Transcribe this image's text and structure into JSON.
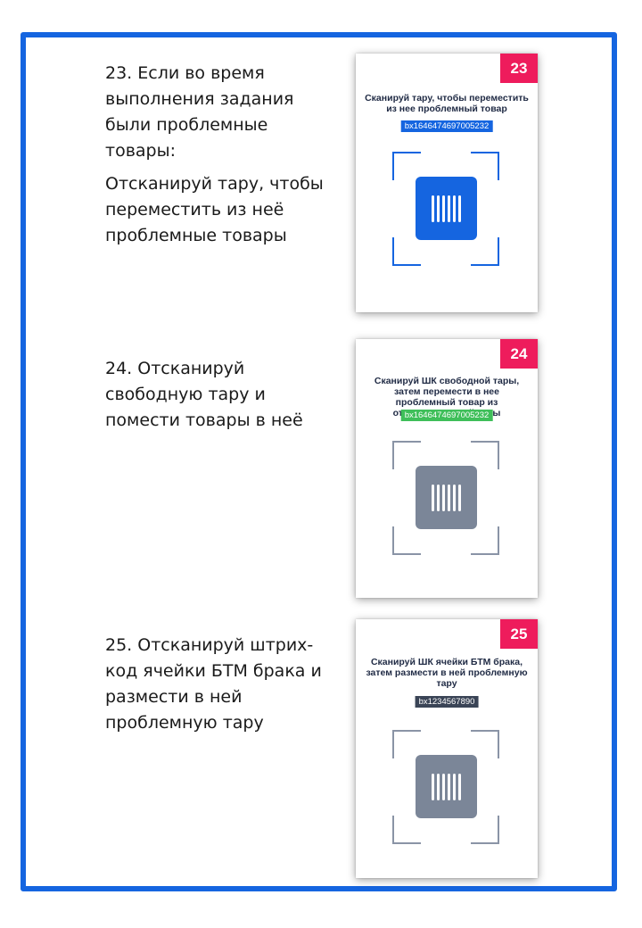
{
  "steps": [
    {
      "paragraphs": [
        "23. Если во время выполнения задания были проблемные товары:",
        "Отсканируй тару, чтобы переместить из неё проблемные товары"
      ],
      "screen": {
        "badge": "23",
        "prompt": "Сканируй тару, чтобы переместить из нее проблемный товар",
        "code": "bx1646474697005232",
        "code_color": "#1565e0",
        "frame_color": "#1565e0",
        "barcode_color": "#1565e0",
        "icon": "barcode-icon"
      }
    },
    {
      "paragraphs": [
        "24. Отсканируй свободную тару и помести товары в неё"
      ],
      "screen": {
        "badge": "24",
        "prompt": "Сканируй ШК свободной тары, затем перемести в нее проблемный товар из отсканированной тары",
        "code": "bx1646474697005232",
        "code_color": "#3fbf5a",
        "frame_color": "#8a94a6",
        "barcode_color": "#7b8698",
        "icon": "barcode-icon"
      }
    },
    {
      "paragraphs": [
        "25. Отсканируй штрих-код ячейки БТМ брака и размести в ней проблемную тару"
      ],
      "screen": {
        "badge": "25",
        "prompt": "Сканируй ШК ячейки БТМ брака, затем размести в ней проблемную тару",
        "code": "bx1234567890",
        "code_color": "#3a4456",
        "frame_color": "#8a94a6",
        "barcode_color": "#7b8698",
        "icon": "barcode-icon"
      }
    }
  ],
  "colors": {
    "frame_border": "#1565e0",
    "badge": "#ee1c5c"
  }
}
